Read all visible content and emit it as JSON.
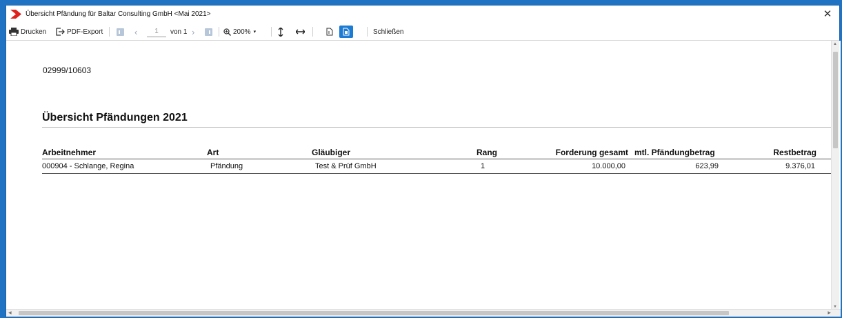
{
  "window": {
    "title": "Übersicht Pfändung für Baltar Consulting GmbH <Mai 2021>",
    "close_symbol": "✕",
    "accent_color": "#e0201b"
  },
  "toolbar": {
    "print_label": "Drucken",
    "pdf_export_label": "PDF-Export",
    "page_value": "1",
    "page_of_label": "von 1",
    "zoom_label": "200%",
    "close_label": "Schließen"
  },
  "report": {
    "doc_id": "02999/10603",
    "title": "Übersicht Pfändungen 2021",
    "columns": [
      "Arbeitnehmer",
      "Art",
      "Gläubiger",
      "Rang",
      "Forderung gesamt",
      "mtl. Pfändungbetrag",
      "Restbetrag"
    ],
    "rows": [
      [
        "000904 - Schlange, Regina",
        "Pfändung",
        "Test & Prüf GmbH",
        "1",
        "10.000,00",
        "623,99",
        "9.376,01"
      ]
    ]
  }
}
